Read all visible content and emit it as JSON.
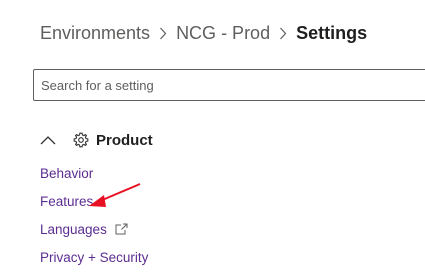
{
  "breadcrumb": {
    "items": [
      "Environments",
      "NCG - Prod"
    ],
    "current": "Settings"
  },
  "search": {
    "placeholder": "Search for a setting",
    "value": ""
  },
  "section": {
    "title": "Product",
    "icon": "gear-icon",
    "toggle_icon": "chevron-up-icon"
  },
  "nav": {
    "items": [
      {
        "label": "Behavior"
      },
      {
        "label": "Features"
      },
      {
        "label": "Languages",
        "icon": "external-link-icon"
      },
      {
        "label": "Privacy + Security"
      }
    ]
  },
  "annotation": {
    "color": "#e81123"
  }
}
